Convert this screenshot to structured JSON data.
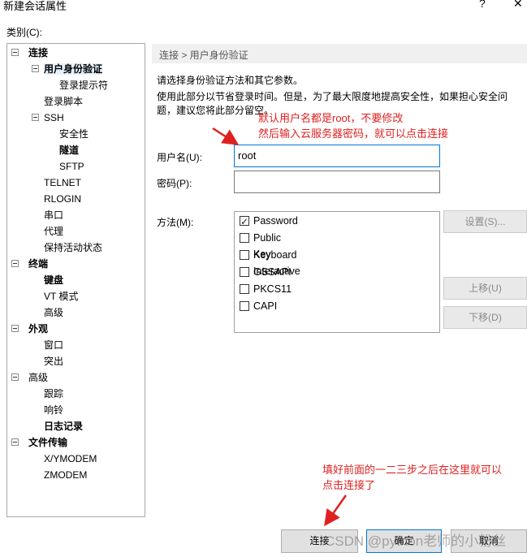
{
  "window": {
    "title": "新建会话属性",
    "help_glyph": "?",
    "close_glyph": "✕"
  },
  "category_label": "类别(C):",
  "tree": {
    "items": [
      {
        "label": "连接",
        "bold": true
      },
      {
        "label": "用户身份验证",
        "bold": true
      },
      {
        "label": "登录提示符"
      },
      {
        "label": "登录脚本"
      },
      {
        "label": "SSH"
      },
      {
        "label": "安全性"
      },
      {
        "label": "隧道",
        "bold": true
      },
      {
        "label": "SFTP"
      },
      {
        "label": "TELNET"
      },
      {
        "label": "RLOGIN"
      },
      {
        "label": "串口"
      },
      {
        "label": "代理"
      },
      {
        "label": "保持活动状态"
      },
      {
        "label": "终端",
        "bold": true
      },
      {
        "label": "键盘",
        "bold": true
      },
      {
        "label": "VT 模式"
      },
      {
        "label": "高级"
      },
      {
        "label": "外观",
        "bold": true
      },
      {
        "label": "窗口"
      },
      {
        "label": "突出"
      },
      {
        "label": "高级"
      },
      {
        "label": "跟踪"
      },
      {
        "label": "响铃"
      },
      {
        "label": "日志记录",
        "bold": true
      },
      {
        "label": "文件传输",
        "bold": true
      },
      {
        "label": "X/YMODEM"
      },
      {
        "label": "ZMODEM"
      }
    ]
  },
  "panel": {
    "breadcrumb": "连接 > 用户身份验证",
    "description": "请选择身份验证方法和其它参数。",
    "hint": "使用此部分以节省登录时间。但是，为了最大限度地提高安全性，如果担心安全问题，建议您将此部分留空。",
    "username_label": "用户名(U):",
    "username_value": "root",
    "password_label": "密码(P):",
    "password_value": "",
    "method_label": "方法(M):",
    "methods": [
      {
        "label": "Password",
        "checked": true
      },
      {
        "label": "Public Key",
        "checked": false
      },
      {
        "label": "Keyboard Interactive",
        "checked": false
      },
      {
        "label": "GSSAPI",
        "checked": false
      },
      {
        "label": "PKCS11",
        "checked": false
      },
      {
        "label": "CAPI",
        "checked": false
      }
    ],
    "settings_button": "设置(S)...",
    "move_up_button": "上移(U)",
    "move_down_button": "下移(D)"
  },
  "annotations": {
    "note1_line1": "默认用户名都是root，不要修改",
    "note1_line2": "然后输入云服务器密码，就可以点击连接",
    "note2_line1": "填好前面的一二三步之后在这里就可以",
    "note2_line2": "点击连接了",
    "color": "#e02020"
  },
  "buttons": {
    "connect": "连接",
    "ok": "确定",
    "cancel": "取消"
  },
  "watermark": "CSDN @python老师的小粉丝"
}
